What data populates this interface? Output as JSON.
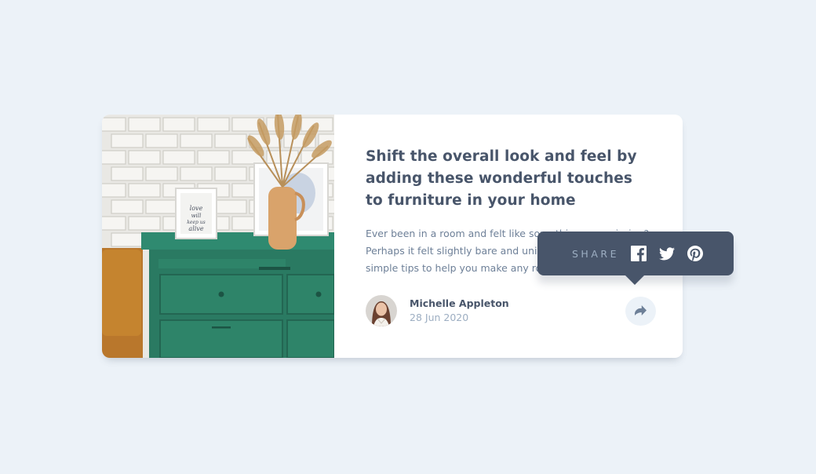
{
  "article": {
    "title": "Shift the overall look and feel by adding these wonderful touches to furniture in your home",
    "excerpt": "Ever been in a room and felt like something was missing? Perhaps it felt slightly bare and uninviting. I've got some simple tips to help you make any room feel complete.",
    "image_frame_text": "love will keep us alive"
  },
  "author": {
    "name": "Michelle Appleton",
    "date": "28 Jun 2020"
  },
  "share": {
    "label": "SHARE",
    "icons": [
      "facebook-icon",
      "twitter-icon",
      "pinterest-icon"
    ],
    "button_icon": "share-arrow-icon"
  },
  "colors": {
    "background": "#ECF2F8",
    "card": "#FFFFFF",
    "heading": "#48556A",
    "body_text": "#6E8098",
    "muted": "#9DAEC2",
    "tooltip": "#48556A",
    "cabinet": "#2E8069"
  }
}
